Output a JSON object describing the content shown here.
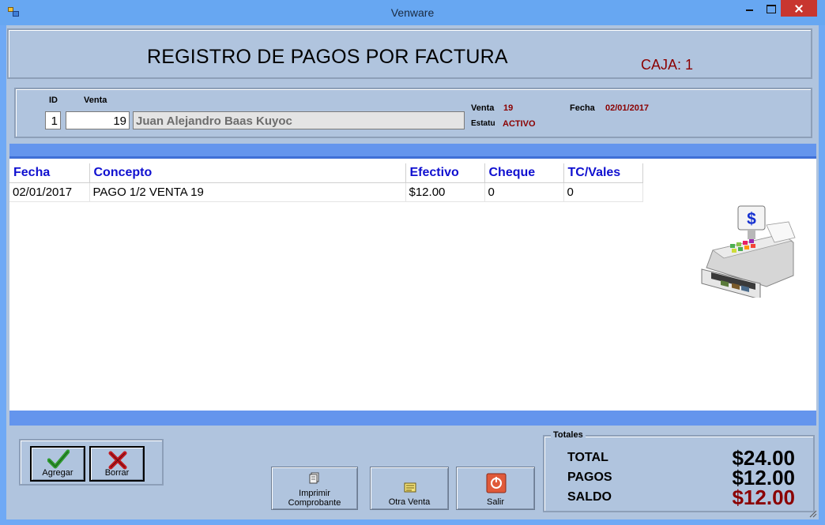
{
  "window": {
    "title": "Venware"
  },
  "header": {
    "title": "REGISTRO DE PAGOS POR FACTURA",
    "caja": "CAJA: 1"
  },
  "sale": {
    "id_label": "ID",
    "venta_label": "Venta",
    "id_value": "1",
    "venta_value": "19",
    "cliente": "Juan Alejandro Baas Kuyoc",
    "venta_info_label": "Venta",
    "venta_info_value": "19",
    "estatus_label": "Estatu",
    "estatus_value": "ACTIVO",
    "fecha_label": "Fecha",
    "fecha_value": "02/01/2017"
  },
  "grid": {
    "columns": [
      "Fecha",
      "Concepto",
      "Efectivo",
      "Cheque",
      "TC/Vales"
    ],
    "rows": [
      [
        "02/01/2017",
        "PAGO 1/2 VENTA 19",
        "$12.00",
        "0",
        "0"
      ]
    ]
  },
  "buttons": {
    "agregar": "Agregar",
    "borrar": "Borrar",
    "imprimir_line1": "Imprimir",
    "imprimir_line2": "Comprobante",
    "otra_venta": "Otra Venta",
    "salir": "Salir"
  },
  "totals": {
    "legend": "Totales",
    "total_label": "TOTAL",
    "total_value": "$24.00",
    "pagos_label": "PAGOS",
    "pagos_value": "$12.00",
    "saldo_label": "SALDO",
    "saldo_value": "$12.00"
  },
  "colors": {
    "background": "#b0c4de",
    "accent_red": "#8b0000",
    "grid_header": "#1010d0",
    "band_blue": "#6495ed"
  },
  "icons": [
    "app-icon",
    "check-icon",
    "x-icon",
    "print-icon",
    "receipt-icon",
    "power-icon",
    "cash-register-icon"
  ]
}
